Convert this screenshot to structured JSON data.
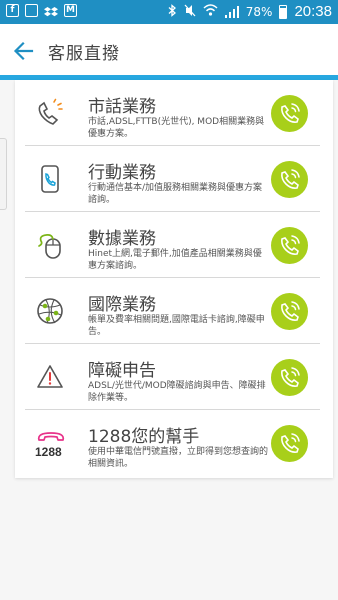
{
  "status_bar": {
    "left_icons": [
      "facebook-icon",
      "gallery-icon",
      "dropbox-icon",
      "gmail-icon"
    ],
    "battery": "78%",
    "time": "20:38"
  },
  "header": {
    "title": "客服直撥"
  },
  "colors": {
    "accent": "#27a7e0",
    "call_button": "#a8cf1a",
    "status_bar": "#1f8fc3"
  },
  "services": [
    {
      "title": "市話業務",
      "desc": "市話,ADSL,FTTB(光世代), MOD相關業務與優惠方案。",
      "icon": "landline-phone-icon"
    },
    {
      "title": "行動業務",
      "desc": "行動通信基本/加值服務相關業務與優惠方案諮詢。",
      "icon": "mobile-phone-icon"
    },
    {
      "title": "數據業務",
      "desc": "Hinet上網,電子郵件,加值產品相關業務與優惠方案諮詢。",
      "icon": "mouse-icon"
    },
    {
      "title": "國際業務",
      "desc": "帳單及費率相關問題,國際電話卡諮詢,障礙申告。",
      "icon": "globe-icon"
    },
    {
      "title": "障礙申告",
      "desc": "ADSL/光世代/MOD障礙諮詢與申告、障礙排除作業等。",
      "icon": "warning-icon"
    },
    {
      "title": "1288您的幫手",
      "desc": "使用中華電信門號直撥，立即得到您想查詢的相關資訊。",
      "icon": "hotline-1288-icon",
      "icon_text": "1288"
    }
  ]
}
